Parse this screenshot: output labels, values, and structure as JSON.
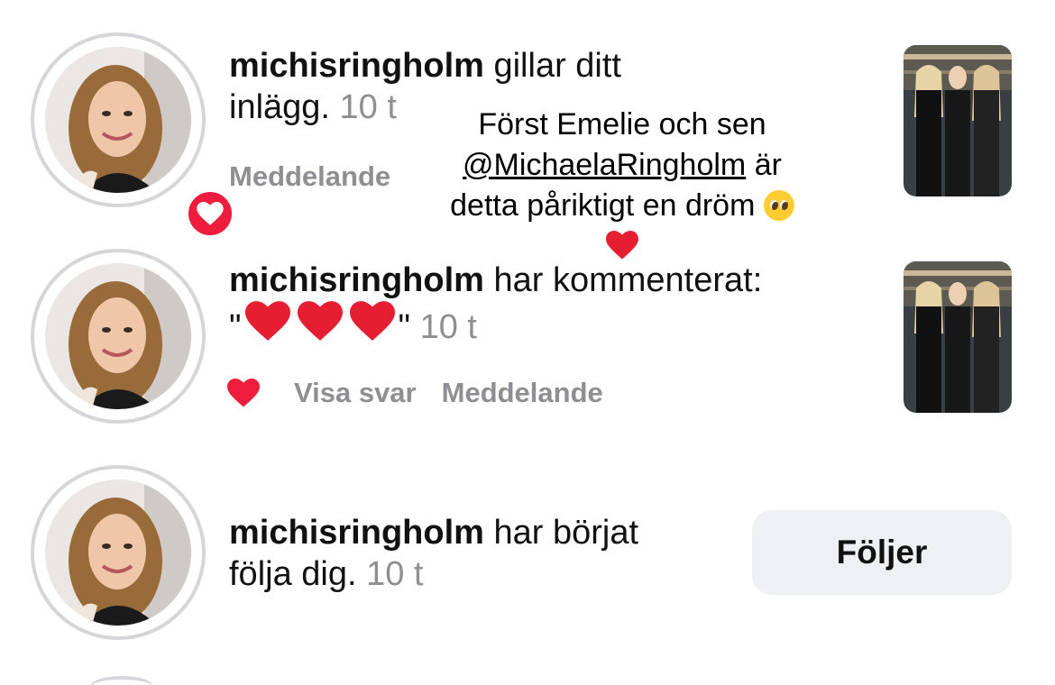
{
  "colors": {
    "like_red": "#ee1d3e",
    "muted_text": "#8e8e93",
    "button_bg": "#eff0f4",
    "avatar_ring": "#d6d6da"
  },
  "notifications": [
    {
      "username": "michisringholm",
      "text_line1": "gillar ditt",
      "text_line2": "inlägg.",
      "time": "10 t",
      "actions": [
        "Meddelande"
      ],
      "badge_icon": "heart-icon"
    },
    {
      "username": "michisringholm",
      "text_line1": "har kommenterat:",
      "comment_open": "\"",
      "comment_close": "\"",
      "comment_hearts": 3,
      "time": "10 t",
      "actions": [
        "Visa svar",
        "Meddelande"
      ],
      "like_icon": "heart-icon"
    },
    {
      "username": "michisringholm",
      "text_line1": "har börjat",
      "text_line2": "följa dig.",
      "time": "10 t",
      "button_label": "Följer"
    }
  ],
  "overlay_caption": {
    "line1": "Först Emelie och sen",
    "mention": "@MichaelaRingholm",
    "line2_rest": "är",
    "line3": "detta påriktigt en dröm"
  }
}
